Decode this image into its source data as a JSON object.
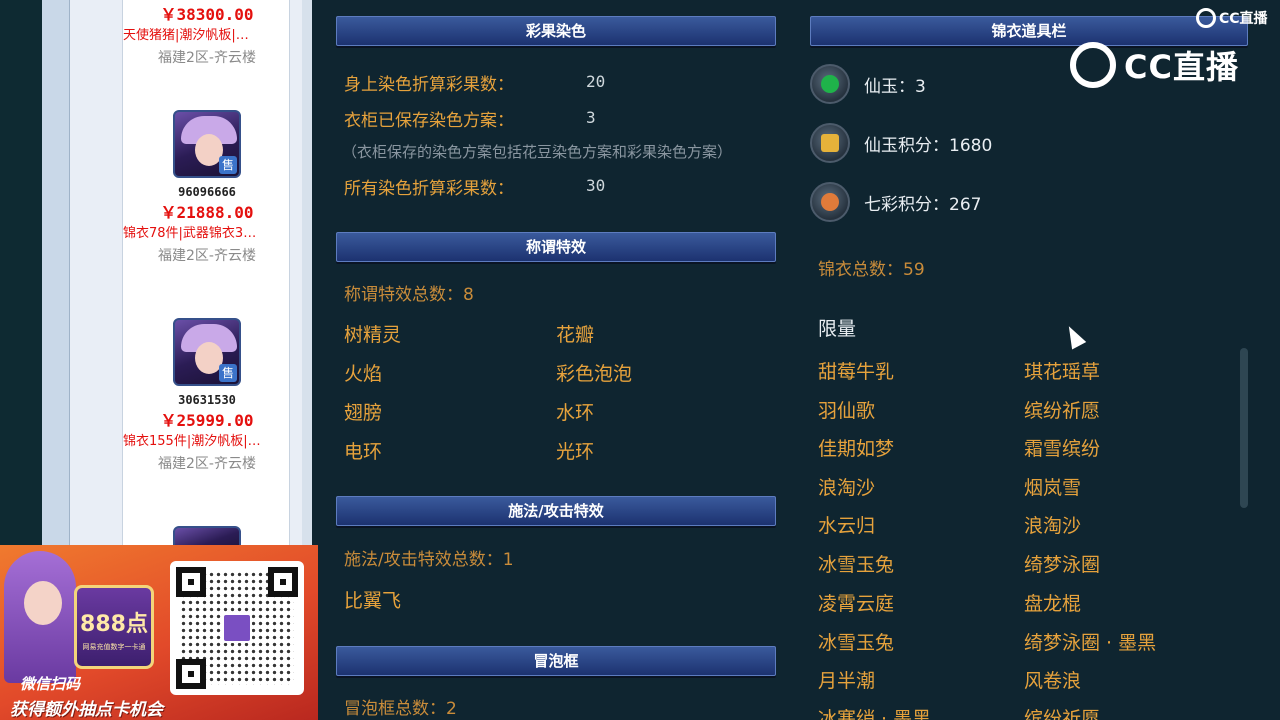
{
  "listings": [
    {
      "uid": "",
      "price": "￥38300.00",
      "tags": "天使猪猪|潮汐帆板|…",
      "server": "福建2区-齐云楼",
      "sale_badge": "售"
    },
    {
      "uid": "96096666",
      "price": "￥21888.00",
      "tags": "锦衣78件|武器锦衣3…",
      "server": "福建2区-齐云楼",
      "sale_badge": "售"
    },
    {
      "uid": "30631530",
      "price": "￥25999.00",
      "tags": "锦衣155件|潮汐帆板|…",
      "server": "福建2区-齐云楼",
      "sale_badge": "售"
    }
  ],
  "dye": {
    "header": "彩果染色",
    "rows": [
      {
        "label": "身上染色折算彩果数：",
        "value": "20"
      },
      {
        "label": "衣柜已保存染色方案：",
        "value": "3"
      },
      {
        "label": "所有染色折算彩果数：",
        "value": "30"
      }
    ],
    "note": "（衣柜保存的染色方案包括花豆染色方案和彩果染色方案）"
  },
  "title_effects": {
    "header": "称谓特效",
    "total": "称谓特效总数：8",
    "items": [
      "树精灵",
      "花瓣",
      "火焰",
      "彩色泡泡",
      "翅膀",
      "水环",
      "电环",
      "光环"
    ]
  },
  "cast_effects": {
    "header": "施法/攻击特效",
    "total": "施法/攻击特效总数：1",
    "items": [
      "比翼飞"
    ]
  },
  "bubble": {
    "header": "冒泡框",
    "total": "冒泡框总数：2"
  },
  "wardrobe": {
    "header": "锦衣道具栏",
    "currencies": [
      {
        "icon": "jade-icon",
        "text": "仙玉：3",
        "color": "#1fb34a"
      },
      {
        "icon": "jade-points-icon",
        "text": "仙玉积分：1680",
        "color": "#e6b23a"
      },
      {
        "icon": "rainbow-points-icon",
        "text": "七彩积分：267",
        "color": "#e07b3a"
      }
    ],
    "total": "锦衣总数：59",
    "limited_title": "限量",
    "limited": [
      "甜莓牛乳",
      "琪花瑶草",
      "羽仙歌",
      "缤纷祈愿",
      "佳期如梦",
      "霜雪缤纷",
      "浪淘沙",
      "烟岚雪",
      "水云归",
      "浪淘沙",
      "冰雪玉兔",
      "绮梦泳圈",
      "凌霄云庭",
      "盘龙棍",
      "冰雪玉兔",
      "绮梦泳圈 · 墨黑",
      "月半潮",
      "风卷浪",
      "冰寒绡 · 墨黑",
      "缤纷祈愿"
    ]
  },
  "overlay": {
    "cc_small": "CC直播",
    "cc_large": "CC直播",
    "promo_card_number": "888点",
    "promo_card_small": "网易充值数字一卡通",
    "promo_line1": "微信扫码",
    "promo_line2": "获得额外抽点卡机会"
  }
}
